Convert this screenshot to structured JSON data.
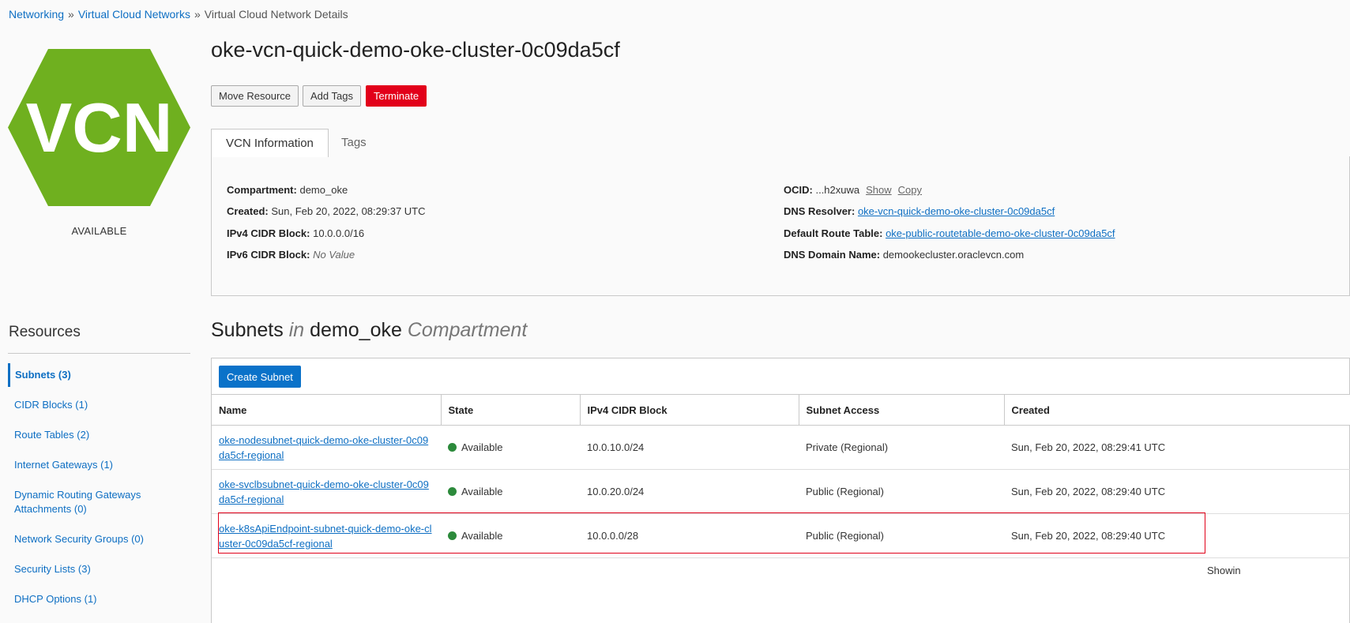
{
  "breadcrumb": {
    "items": [
      "Networking",
      "Virtual Cloud Networks"
    ],
    "separator": "»",
    "current": "Virtual Cloud Network Details"
  },
  "vcn_icon": {
    "label": "VCN",
    "color": "#6fb01f",
    "status": "AVAILABLE"
  },
  "title": "oke-vcn-quick-demo-oke-cluster-0c09da5cf",
  "actions": {
    "move": "Move Resource",
    "add_tags": "Add Tags",
    "terminate": "Terminate",
    "terminate_color": "#e2001a"
  },
  "tabs": [
    "VCN Information",
    "Tags"
  ],
  "info": {
    "compartment_label": "Compartment:",
    "compartment": "demo_oke",
    "created_label": "Created:",
    "created": "Sun, Feb 20, 2022, 08:29:37 UTC",
    "ipv4_label": "IPv4 CIDR Block:",
    "ipv4": "10.0.0.0/16",
    "ipv6_label": "IPv6 CIDR Block:",
    "ipv6": "No Value",
    "ocid_label": "OCID:",
    "ocid": "...h2xuwa",
    "ocid_show": "Show",
    "ocid_copy": "Copy",
    "dns_resolver_label": "DNS Resolver:",
    "dns_resolver": "oke-vcn-quick-demo-oke-cluster-0c09da5cf",
    "route_table_label": "Default Route Table:",
    "route_table": "oke-public-routetable-demo-oke-cluster-0c09da5cf",
    "dns_domain_label": "DNS Domain Name:",
    "dns_domain": "demookecluster.oraclevcn.com"
  },
  "resources": {
    "heading": "Resources",
    "items": [
      "Subnets (3)",
      "CIDR Blocks (1)",
      "Route Tables (2)",
      "Internet Gateways (1)",
      "Dynamic Routing Gateways Attachments (0)",
      "Network Security Groups (0)",
      "Security Lists (3)",
      "DHCP Options (1)"
    ]
  },
  "subnets": {
    "heading_main": "Subnets",
    "heading_in": "in",
    "heading_compartment": "demo_oke",
    "heading_suffix": "Compartment",
    "create_button": "Create Subnet",
    "columns": [
      "Name",
      "State",
      "IPv4 CIDR Block",
      "Subnet Access",
      "Created"
    ],
    "rows": [
      {
        "name": "oke-nodesubnet-quick-demo-oke-cluster-0c09da5cf-regional",
        "state": "Available",
        "cidr": "10.0.10.0/24",
        "access": "Private (Regional)",
        "created": "Sun, Feb 20, 2022, 08:29:41 UTC"
      },
      {
        "name": "oke-svclbsubnet-quick-demo-oke-cluster-0c09da5cf-regional",
        "state": "Available",
        "cidr": "10.0.20.0/24",
        "access": "Public (Regional)",
        "created": "Sun, Feb 20, 2022, 08:29:40 UTC"
      },
      {
        "name": "oke-k8sApiEndpoint-subnet-quick-demo-oke-cluster-0c09da5cf-regional",
        "state": "Available",
        "cidr": "10.0.0.0/28",
        "access": "Public (Regional)",
        "created": "Sun, Feb 20, 2022, 08:29:40 UTC"
      }
    ],
    "state_color": "#2c8a3b",
    "showing": "Showin"
  }
}
